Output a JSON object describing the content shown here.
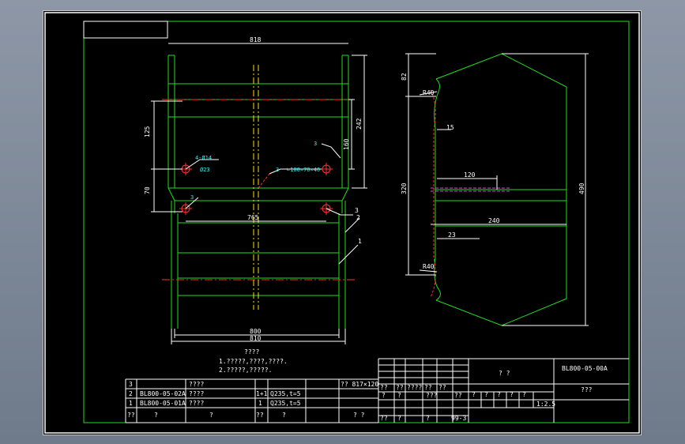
{
  "drawing": {
    "code": "BL800-05-00A",
    "name": "???",
    "tech_title": "????",
    "tech_notes": [
      "1.?????,????,????.",
      "2.?????,?????."
    ],
    "title_cell": "? ?"
  },
  "dims": {
    "top_width": "818",
    "bottom_width_inner": "800",
    "bottom_width_outer": "810",
    "mid_width": "765",
    "hole_note": "4-Ø14",
    "hole_sub": "Ø23",
    "h125": "125",
    "h70": "70",
    "h242": "242",
    "h160": "160",
    "angle_note": "∟100×70×40",
    "weld3": "3",
    "weld_label": "3",
    "balloon3": "3",
    "balloon2": "2",
    "balloon1": "1",
    "r_top": "R40",
    "r_bot": "R40",
    "d82": "82",
    "d15": "15",
    "d120": "120",
    "d320": "320",
    "d490": "490",
    "d240": "240",
    "d23": "23"
  },
  "bom": [
    {
      "no": "3",
      "code": "",
      "name": "????",
      "qty": "",
      "material": "",
      "note": "?? 817×120"
    },
    {
      "no": "2",
      "code": "BL800-05-02A",
      "name": "????",
      "qty": "1+1",
      "material": "Q235,t=5",
      "note": ""
    },
    {
      "no": "1",
      "code": "BL800-05-01A",
      "name": "????",
      "qty": "1",
      "material": "Q235,t=5",
      "note": ""
    },
    {
      "no": "??",
      "code": "?",
      "name": "?",
      "qty": "??",
      "material": "?",
      "note": "? ?"
    }
  ],
  "title_block": {
    "row_a": [
      "??",
      "??",
      "????",
      "??",
      "??"
    ],
    "row_b": [
      "?",
      "?",
      "???",
      "??"
    ],
    "scale": "1:2.5",
    "sheet_marks": [
      "?",
      "?",
      "?",
      "?",
      "?"
    ],
    "date": "99-3",
    "misc": [
      "??",
      "?",
      "?"
    ]
  }
}
